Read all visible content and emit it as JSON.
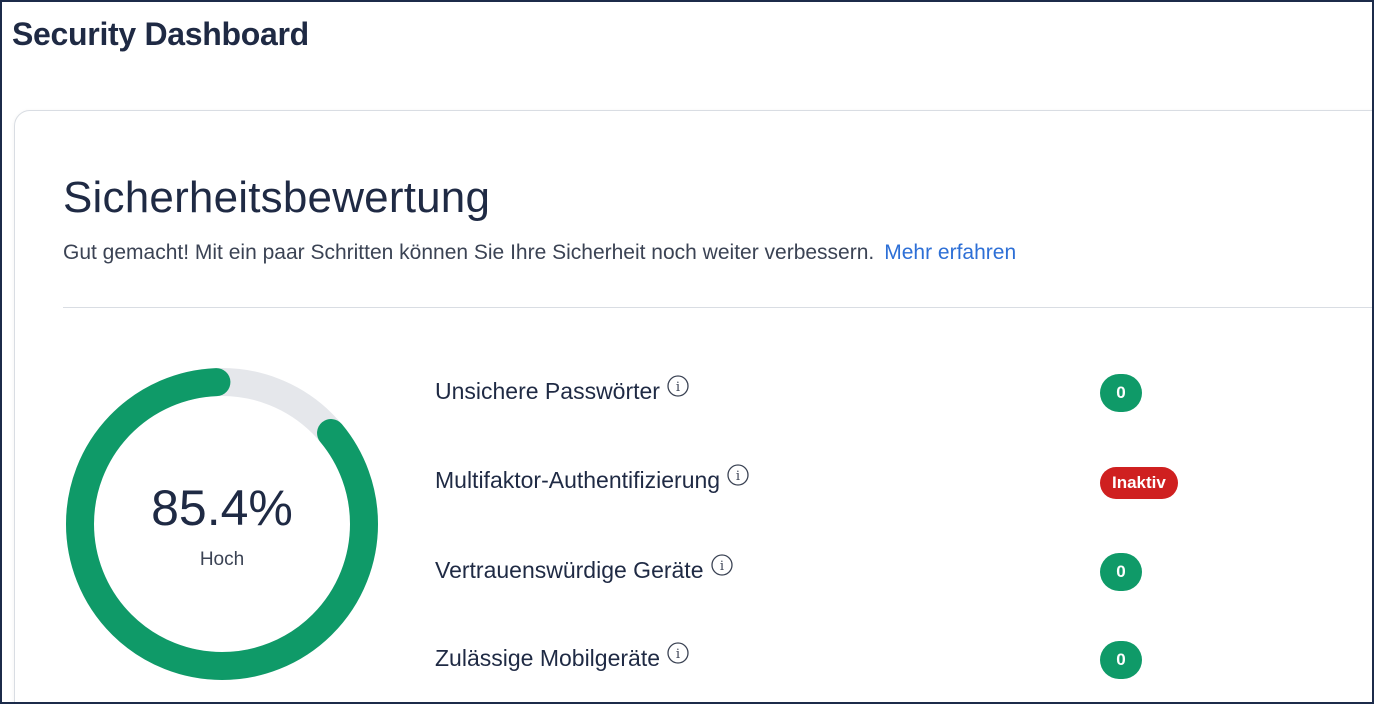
{
  "page": {
    "title": "Security Dashboard"
  },
  "score_card": {
    "title": "Sicherheitsbewertung",
    "subtitle": "Gut gemacht! Mit ein paar Schritten können Sie Ihre Sicherheit noch weiter verbessern.",
    "learn_more": "Mehr erfahren",
    "gauge": {
      "value_text": "85.4%",
      "value_fraction": 0.854,
      "level_label": "Hoch",
      "fill_color": "#0f9a68",
      "track_color": "#e5e7eb"
    },
    "metrics": [
      {
        "label": "Unsichere Passwörter",
        "badge": "0",
        "badge_type": "count",
        "badge_color": "#0f9a68"
      },
      {
        "label": "Multifaktor-Authentifizierung",
        "badge": "Inaktiv",
        "badge_type": "status",
        "badge_color": "#cf2020"
      },
      {
        "label": "Vertrauenswürdige Geräte",
        "badge": "0",
        "badge_type": "count",
        "badge_color": "#0f9a68"
      },
      {
        "label": "Zulässige Mobilgeräte",
        "badge": "0",
        "badge_type": "count",
        "badge_color": "#0f9a68"
      }
    ],
    "info_icon": "info-circle-icon"
  }
}
